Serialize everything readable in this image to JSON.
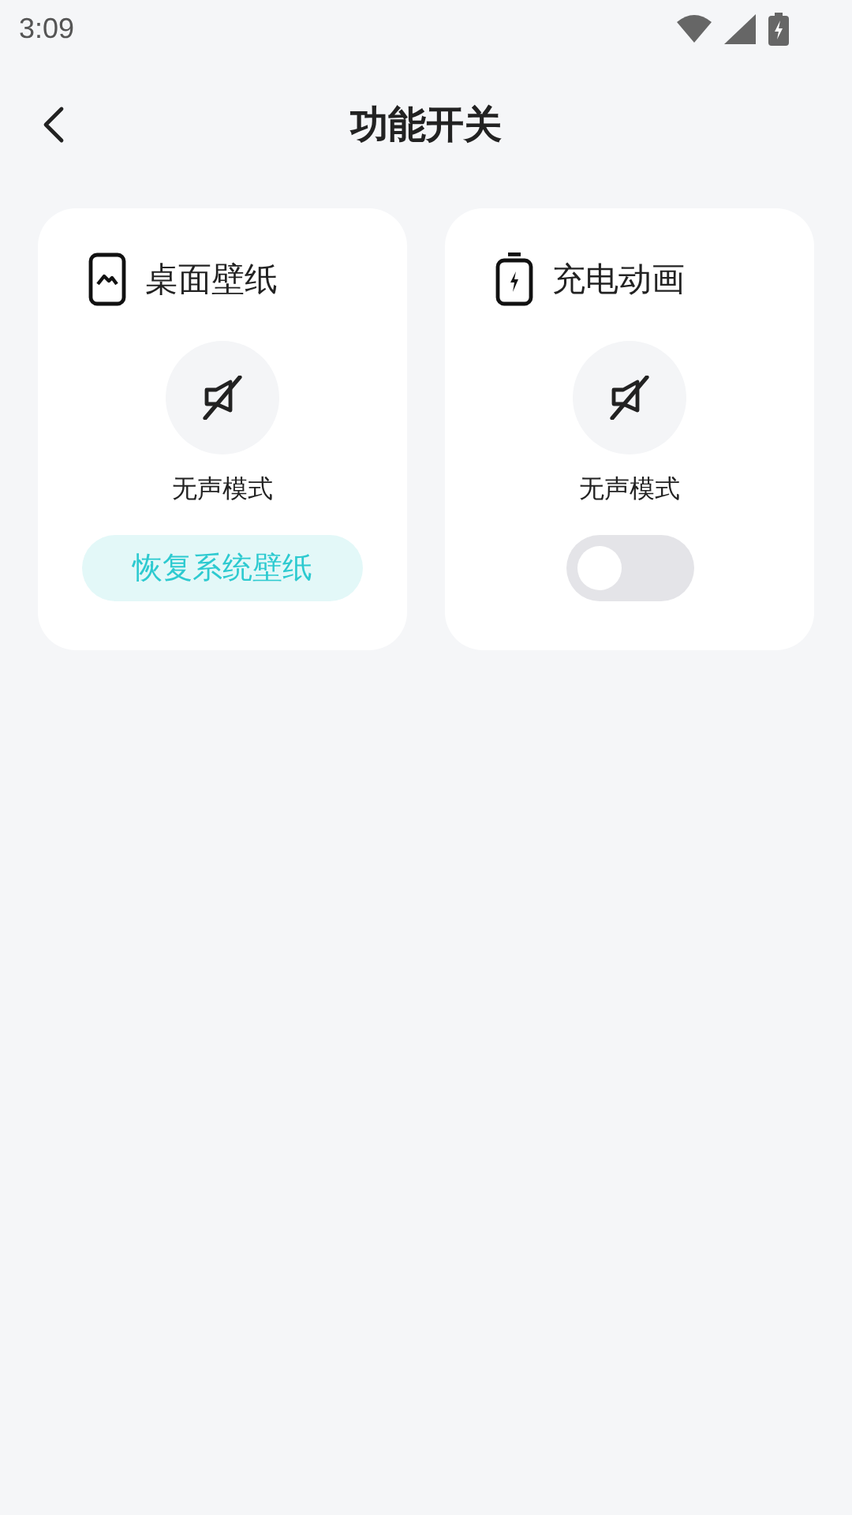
{
  "status_bar": {
    "time": "3:09"
  },
  "header": {
    "title": "功能开关"
  },
  "cards": [
    {
      "kind": "wallpaper",
      "title": "桌面壁纸",
      "mode_label": "无声模式",
      "control": {
        "kind": "button",
        "label": "恢复系统壁纸"
      }
    },
    {
      "kind": "charging",
      "title": "充电动画",
      "mode_label": "无声模式",
      "control": {
        "kind": "toggle",
        "on": false
      }
    }
  ]
}
